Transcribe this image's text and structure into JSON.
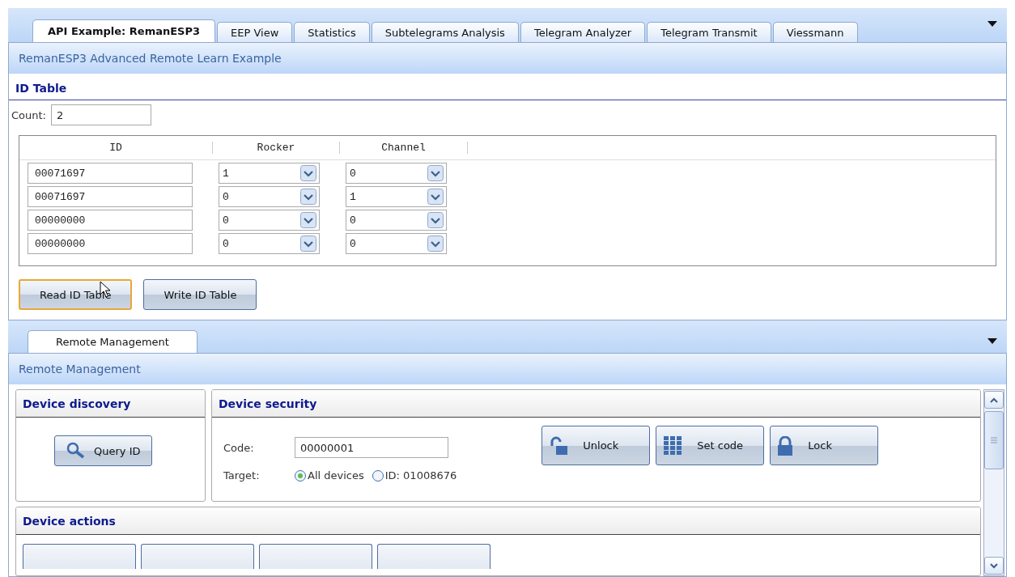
{
  "main_tabs": [
    {
      "label": "API Example: RemanESP3",
      "selected": true
    },
    {
      "label": "EEP View",
      "selected": false
    },
    {
      "label": "Statistics",
      "selected": false
    },
    {
      "label": "Subtelegrams Analysis",
      "selected": false
    },
    {
      "label": "Telegram Analyzer",
      "selected": false
    },
    {
      "label": "Telegram Transmit",
      "selected": false
    },
    {
      "label": "Viessmann",
      "selected": false
    }
  ],
  "panel_title": "RemanESP3 Advanced Remote Learn Example",
  "id_table": {
    "heading": "ID Table",
    "count_label": "Count:",
    "count_value": "2",
    "columns": [
      "ID",
      "Rocker",
      "Channel"
    ],
    "rows": [
      {
        "id": "00071697",
        "rocker": "1",
        "channel": "0"
      },
      {
        "id": "00071697",
        "rocker": "0",
        "channel": "1"
      },
      {
        "id": "00000000",
        "rocker": "0",
        "channel": "0"
      },
      {
        "id": "00000000",
        "rocker": "0",
        "channel": "0"
      }
    ],
    "buttons": [
      {
        "label": "Read ID Table",
        "focused": true
      },
      {
        "label": "Write ID Table",
        "focused": false
      }
    ]
  },
  "lower_tabs": [
    {
      "label": "Remote Management",
      "selected": true
    }
  ],
  "remote_title": "Remote Management",
  "discovery": {
    "heading": "Device discovery",
    "button": "Query ID"
  },
  "security": {
    "heading": "Device security",
    "code_label": "Code:",
    "code_value": "00000001",
    "target_label": "Target:",
    "targets": [
      {
        "label": "All devices",
        "selected": true
      },
      {
        "label": "ID: 01008676",
        "selected": false
      }
    ],
    "buttons": [
      {
        "label": "Unlock",
        "kind": "unlock"
      },
      {
        "label": "Set code",
        "kind": "grid"
      },
      {
        "label": "Lock",
        "kind": "lock"
      }
    ]
  },
  "actions": {
    "heading": "Device actions"
  }
}
